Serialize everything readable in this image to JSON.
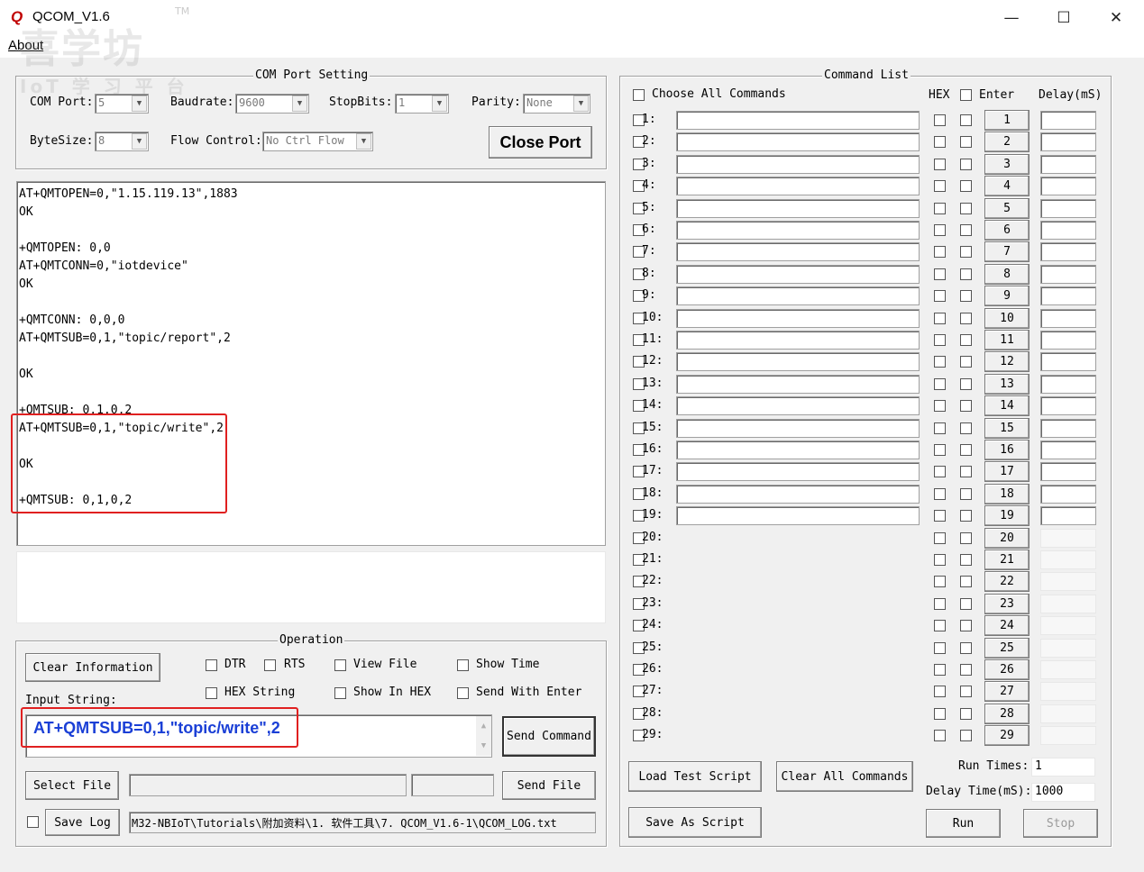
{
  "window": {
    "title": "QCOM_V1.6",
    "app_icon": "Q",
    "trademark": "TM",
    "minimize_icon": "—",
    "maximize_icon": "☐",
    "close_icon": "✕"
  },
  "menu": {
    "about": "About"
  },
  "watermark": {
    "line1": "喜学坊",
    "line2": "IoT 学 习 平 台"
  },
  "com_port": {
    "title": "COM Port Setting",
    "com_port_label": "COM Port:",
    "com_port_value": "5",
    "baudrate_label": "Baudrate:",
    "baudrate_value": "9600",
    "stopbits_label": "StopBits:",
    "stopbits_value": "1",
    "parity_label": "Parity:",
    "parity_value": "None",
    "bytesize_label": "ByteSize:",
    "bytesize_value": "8",
    "flow_label": "Flow Control:",
    "flow_value": "No Ctrl Flow",
    "close_port": "Close Port"
  },
  "log_lines": [
    "AT+QMTOPEN=0,\"1.15.119.13\",1883",
    "OK",
    "",
    "+QMTOPEN: 0,0",
    "AT+QMTCONN=0,\"iotdevice\"",
    "OK",
    "",
    "+QMTCONN: 0,0,0",
    "AT+QMTSUB=0,1,\"topic/report\",2",
    "",
    "OK",
    "",
    "+QMTSUB: 0,1,0,2",
    "AT+QMTSUB=0,1,\"topic/write\",2",
    "",
    "OK",
    "",
    "+QMTSUB: 0,1,0,2"
  ],
  "operation": {
    "title": "Operation",
    "clear_info": "Clear Information",
    "dtr": "DTR",
    "rts": "RTS",
    "view_file": "View File",
    "show_time": "Show Time",
    "hex_string": "HEX String",
    "show_in_hex": "Show In HEX",
    "send_with_enter": "Send With Enter",
    "input_label": "Input String:",
    "input_value": "AT+QMTSUB=0,1,\"topic/write\",2",
    "send_command": "Send Command",
    "select_file": "Select File",
    "send_file": "Send File",
    "save_log": "Save Log",
    "log_path": "M32-NBIoT\\Tutorials\\附加资料\\1. 软件工具\\7. QCOM_V1.6-1\\QCOM_LOG.txt",
    "scroll_up_icon": "▲",
    "scroll_down_icon": "▼"
  },
  "command_list": {
    "title": "Command List",
    "choose_all": "Choose All Commands",
    "hex_header": "HEX",
    "enter_header": "Enter",
    "delay_header": "Delay(mS)",
    "rows": [
      {
        "label": "1:",
        "btn": "1"
      },
      {
        "label": "2:",
        "btn": "2"
      },
      {
        "label": "3:",
        "btn": "3"
      },
      {
        "label": "4:",
        "btn": "4"
      },
      {
        "label": "5:",
        "btn": "5"
      },
      {
        "label": "6:",
        "btn": "6"
      },
      {
        "label": "7:",
        "btn": "7"
      },
      {
        "label": "8:",
        "btn": "8"
      },
      {
        "label": "9:",
        "btn": "9"
      },
      {
        "label": "10:",
        "btn": "10"
      },
      {
        "label": "11:",
        "btn": "11"
      },
      {
        "label": "12:",
        "btn": "12"
      },
      {
        "label": "13:",
        "btn": "13"
      },
      {
        "label": "14:",
        "btn": "14"
      },
      {
        "label": "15:",
        "btn": "15"
      },
      {
        "label": "16:",
        "btn": "16"
      },
      {
        "label": "17:",
        "btn": "17"
      },
      {
        "label": "18:",
        "btn": "18"
      },
      {
        "label": "19:",
        "btn": "19"
      },
      {
        "label": "20:",
        "btn": "20"
      },
      {
        "label": "21:",
        "btn": "21"
      },
      {
        "label": "22:",
        "btn": "22"
      },
      {
        "label": "23:",
        "btn": "23"
      },
      {
        "label": "24:",
        "btn": "24"
      },
      {
        "label": "25:",
        "btn": "25"
      },
      {
        "label": "26:",
        "btn": "26"
      },
      {
        "label": "27:",
        "btn": "27"
      },
      {
        "label": "28:",
        "btn": "28"
      },
      {
        "label": "29:",
        "btn": "29"
      }
    ],
    "load_script": "Load Test Script",
    "clear_all": "Clear All Commands",
    "save_script": "Save As Script",
    "run_times_label": "Run Times:",
    "run_times_value": "1",
    "delay_time_label": "Delay Time(mS):",
    "delay_time_value": "1000",
    "run": "Run",
    "stop": "Stop"
  },
  "colors": {
    "highlight_box": "#e02020",
    "input_text": "#1a3fd6",
    "app_icon": "#c00000"
  }
}
